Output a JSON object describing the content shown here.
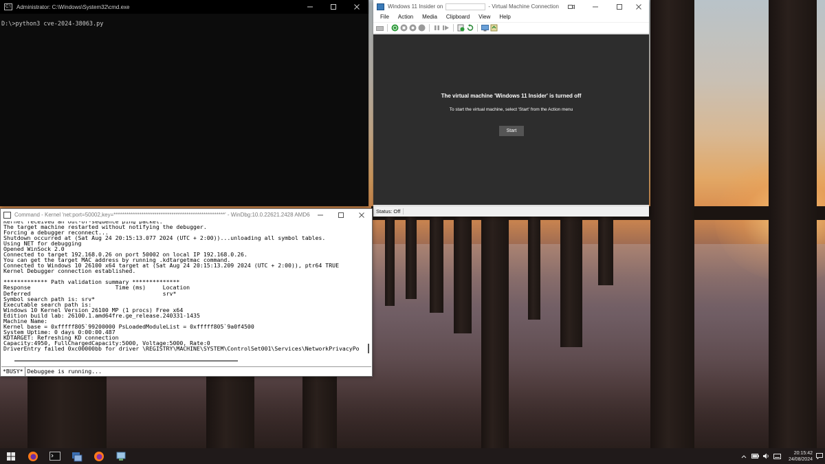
{
  "cmd": {
    "title": "Administrator: C:\\Windows\\System32\\cmd.exe",
    "lines": [
      "D:\\>python3 cve-2024-38063.py"
    ]
  },
  "vm": {
    "title_prefix": "Windows 11 Insider on",
    "title_suffix": "- Virtual Machine Connection",
    "menu": [
      "File",
      "Action",
      "Media",
      "Clipboard",
      "View",
      "Help"
    ],
    "off_message": "The virtual machine 'Windows 11 Insider' is turned off",
    "sub_message": "To start the virtual machine, select 'Start' from the Action menu",
    "start_label": "Start",
    "status": "Status: Off",
    "toolbar_icons": [
      "ctrl-alt-del-icon",
      "start-icon",
      "turn-off-icon",
      "shutdown-icon",
      "save-icon",
      "pause-icon",
      "reset-icon",
      "checkpoint-icon",
      "revert-icon",
      "enhanced-session-icon",
      "share-icon"
    ]
  },
  "windbg": {
    "title": "Command - Kernel 'net:port=50002,key=****************************************************' - WinDbg:10.0.22621.2428 AMD64",
    "lines": [
      "Kernel received an out-of-sequence ping packet.",
      "The target machine restarted without notifying the debugger.",
      "Forcing a debugger reconnect...",
      "Shutdown occurred at (Sat Aug 24 20:15:13.077 2024 (UTC + 2:00))...unloading all symbol tables.",
      "Using NET for debugging",
      "Opened WinSock 2.0",
      "Connected to target 192.168.0.26 on port 50002 on local IP 192.168.0.26.",
      "You can get the target MAC address by running .kdtargetmac command.",
      "Connected to Windows 10 26100 x64 target at (Sat Aug 24 20:15:13.209 2024 (UTC + 2:00)), ptr64 TRUE",
      "Kernel Debugger connection established.",
      "",
      "************* Path validation summary **************",
      "Response                         Time (ms)     Location",
      "Deferred                                       srv*",
      "Symbol search path is: srv*",
      "Executable search path is:",
      "Windows 10 Kernel Version 26100 MP (1 procs) Free x64",
      "Edition build lab: 26100.1.amd64fre.ge_release.240331-1435",
      "Machine Name:",
      "Kernel base = 0xfffff805`99200000 PsLoadedModuleList = 0xfffff805`9a0f4500",
      "System Uptime: 0 days 0:00:00.487",
      "KDTARGET: Refreshing KD connection",
      "Capacity:4950, FullChargedCapacity:5000, Voltage:5000, Rate:0",
      "DriverEntry failed 0xc00000bb for driver \\REGISTRY\\MACHINE\\SYSTEM\\ControlSet001\\Services\\NetworkPrivacyPo"
    ],
    "prompt": "*BUSY*",
    "status": "Debuggee is running..."
  },
  "taskbar": {
    "items": [
      "start-icon",
      "firefox-icon",
      "terminal-icon",
      "hyperv-manager-icon",
      "firefox-icon",
      "network-app-icon"
    ],
    "time": "20:15:42",
    "date": "24/08/2024",
    "tray_icons": [
      "chevron-up-icon",
      "battery-icon",
      "speaker-icon",
      "keyboard-icon",
      "notification-icon"
    ]
  }
}
